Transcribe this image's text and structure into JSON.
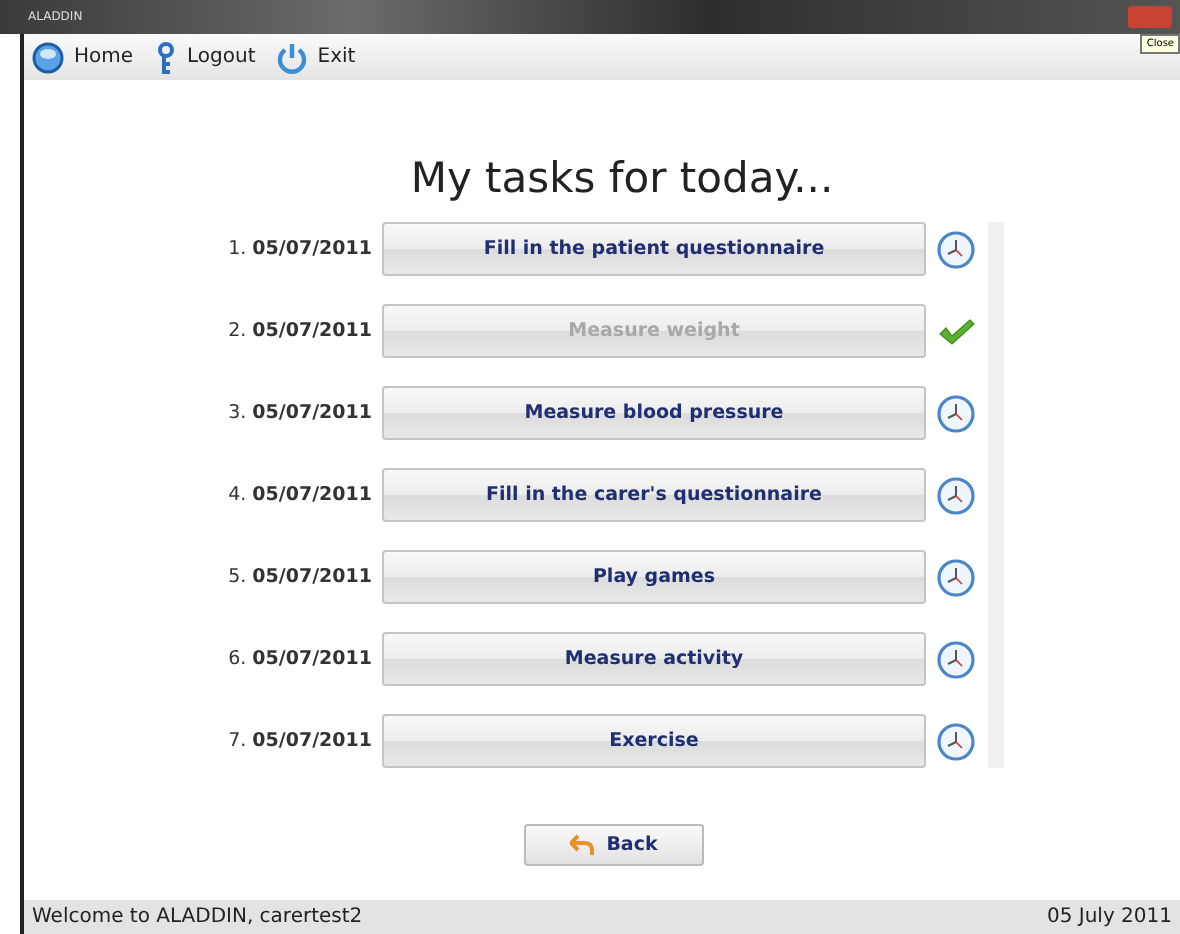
{
  "window": {
    "title": "ALADDIN",
    "tooltip": "Close"
  },
  "toolbar": [
    {
      "kind": "home",
      "label": "Home"
    },
    {
      "kind": "logout",
      "label": "Logout"
    },
    {
      "kind": "exit",
      "label": "Exit"
    }
  ],
  "heading": "My tasks for today...",
  "tasks": [
    {
      "number": "1.",
      "date": "05/07/2011",
      "label": "Fill in the patient questionnaire",
      "done": false
    },
    {
      "number": "2.",
      "date": "05/07/2011",
      "label": "Measure weight",
      "done": true
    },
    {
      "number": "3.",
      "date": "05/07/2011",
      "label": "Measure blood pressure",
      "done": false
    },
    {
      "number": "4.",
      "date": "05/07/2011",
      "label": "Fill in the carer's questionnaire",
      "done": false
    },
    {
      "number": "5.",
      "date": "05/07/2011",
      "label": "Play games",
      "done": false
    },
    {
      "number": "6.",
      "date": "05/07/2011",
      "label": "Measure activity",
      "done": false
    },
    {
      "number": "7.",
      "date": "05/07/2011",
      "label": "Exercise",
      "done": false
    }
  ],
  "back_button": "Back",
  "status_bar": {
    "welcome": "Welcome to ALADDIN, carertest2",
    "date": "05 July 2011"
  }
}
